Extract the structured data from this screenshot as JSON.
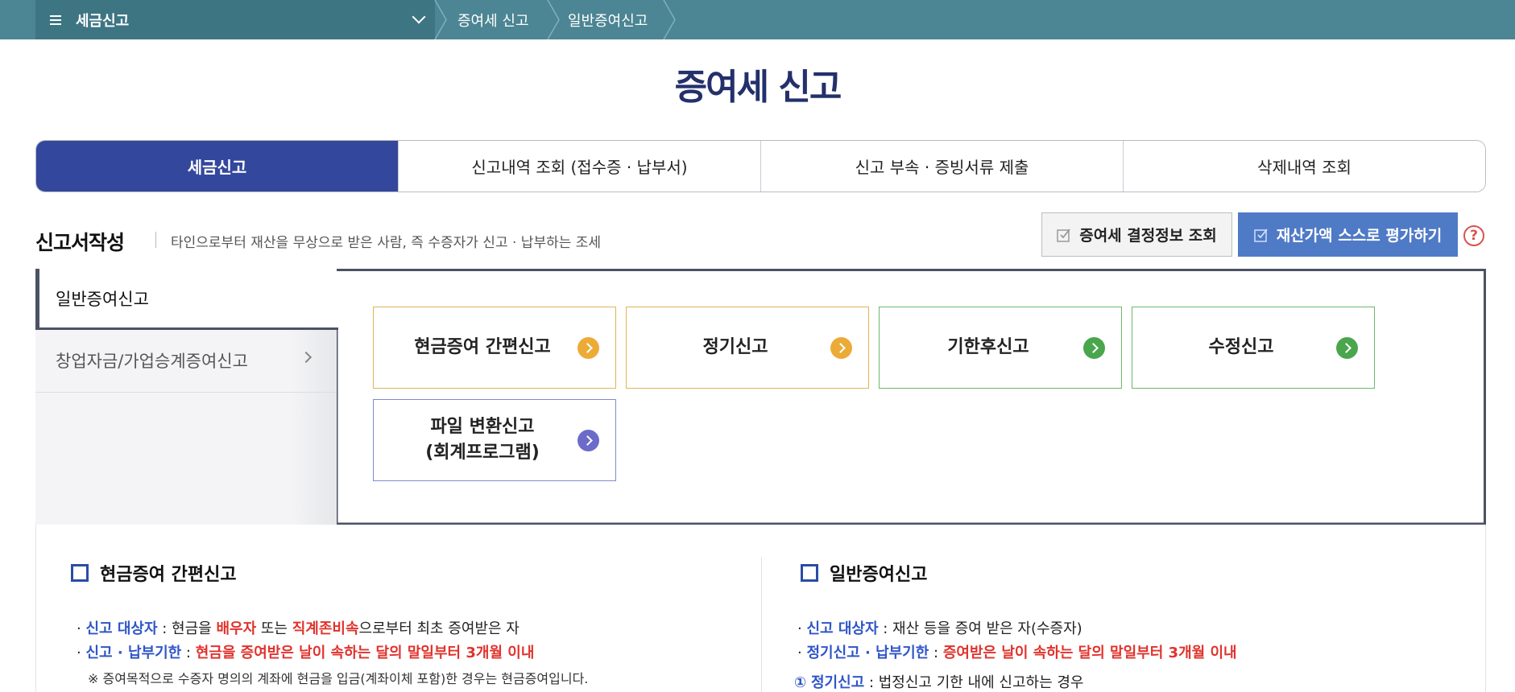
{
  "topbar": {
    "menu_label": "세금신고",
    "breadcrumbs": [
      "증여세 신고",
      "일반증여신고"
    ]
  },
  "page_title": "증여세 신고",
  "tabs": [
    {
      "label": "세금신고",
      "active": true
    },
    {
      "label": "신고내역 조회 (접수증 · 납부서)",
      "active": false
    },
    {
      "label": "신고 부속 · 증빙서류 제출",
      "active": false
    },
    {
      "label": "삭제내역 조회",
      "active": false
    }
  ],
  "section": {
    "title": "신고서작성",
    "description": "타인으로부터 재산을 무상으로 받은 사람, 즉 수증자가 신고 · 납부하는 조세",
    "decision_button": "증여세 결정정보 조회",
    "eval_button": "재산가액 스스로 평가하기",
    "help_label": "?"
  },
  "side_menu": {
    "active": "일반증여신고",
    "items": [
      "창업자금/가업승계증여신고"
    ]
  },
  "cards": [
    {
      "label": "현금증여 간편신고",
      "color": "orange"
    },
    {
      "label": "정기신고",
      "color": "orange"
    },
    {
      "label": "기한후신고",
      "color": "green"
    },
    {
      "label": "수정신고",
      "color": "green"
    },
    {
      "label_line1": "파일 변환신고",
      "label_line2": "(회계프로그램)",
      "color": "purple"
    }
  ],
  "colors": {
    "topbar": "#4c8593",
    "tab_active": "#33479c",
    "title": "#23306b",
    "eval_button": "#4f7ac6",
    "highlight_blue": "#2f55c8",
    "highlight_red": "#e0332d"
  },
  "info_left": {
    "heading": "현금증여 간편신고",
    "line1": {
      "b1": "신고 대상자",
      "t1": " : 현금을 ",
      "r1": "배우자",
      "t2": " 또는 ",
      "r2": "직계존비속",
      "t3": "으로부터 최초 증여받은 자"
    },
    "line2": {
      "b1": "신고 · 납부기한",
      "t1": " : ",
      "r1": "현금을 증여받은 날이 속하는 달의 말일부터 3개월 이내"
    },
    "note": "※ 증여목적으로 수증자 명의의 계좌에 현금을 입금(계좌이체 포함)한 경우는 현금증여입니다."
  },
  "info_right": {
    "heading": "일반증여신고",
    "line1": {
      "b1": "신고 대상자",
      "t1": " : 재산 등을 증여 받은 자(수증자)"
    },
    "line2": {
      "b1": "정기신고 · 납부기한",
      "t1": " : ",
      "r1": "증여받은 날이 속하는 달의 말일부터 3개월 이내"
    },
    "line3": {
      "num": "①",
      "b1": "정기신고",
      "t1": " : 법정신고 기한 내에 신고하는 경우"
    }
  }
}
